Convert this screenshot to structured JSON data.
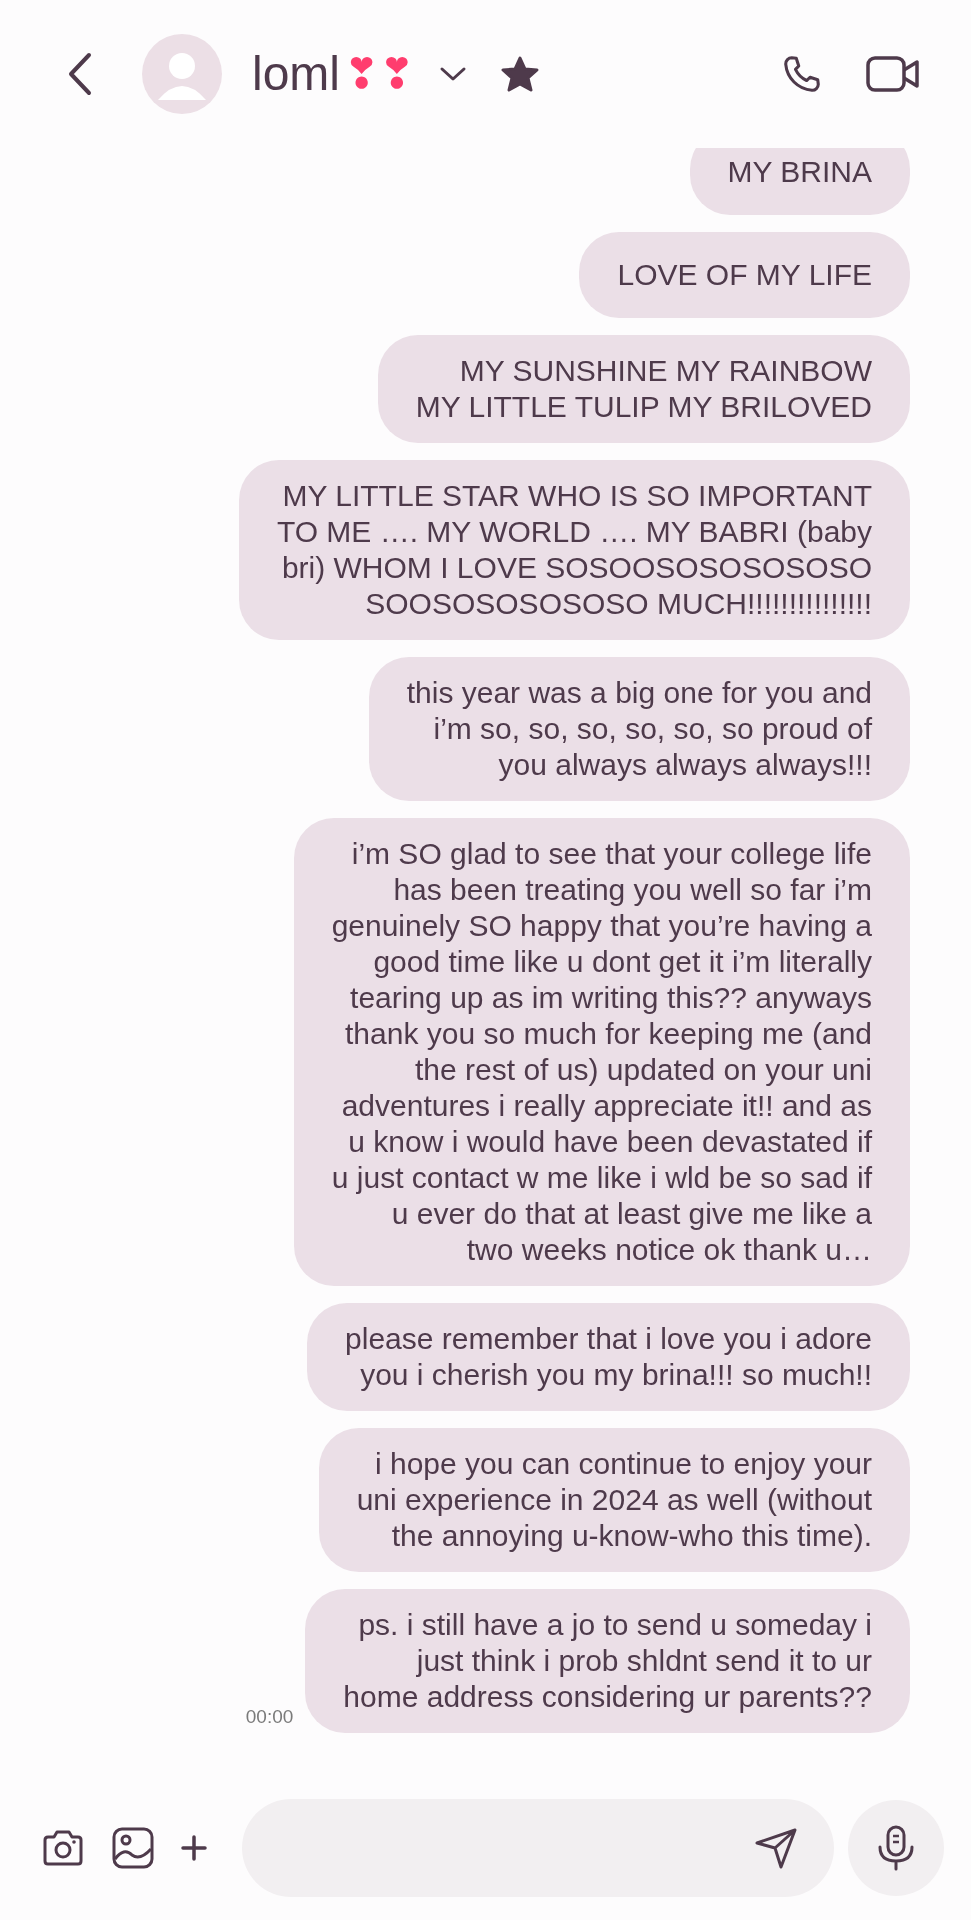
{
  "header": {
    "contact_name": "loml",
    "name_emoji": "❣❣",
    "starred": true
  },
  "messages": [
    {
      "lines": [
        "MY BRINA"
      ]
    },
    {
      "lines": [
        "LOVE OF MY LIFE"
      ]
    },
    {
      "lines": [
        "MY SUNSHINE MY RAINBOW",
        "MY LITTLE TULIP MY BRILOVED"
      ]
    },
    {
      "lines": [
        "MY LITTLE STAR WHO IS SO IMPORTANT",
        "TO ME …. MY WORLD …. MY BABRI (baby",
        "bri) WHOM I LOVE SOSOOSOSOSOSOSO",
        "SOOSOSOSOSOSO MUCH!!!!!!!!!!!!!!!"
      ]
    },
    {
      "lines": [
        "this year was a big one for you and",
        "i’m so, so, so, so, so, so proud of",
        "you always always always!!!"
      ]
    },
    {
      "lines": [
        "i’m SO glad to see that your college life",
        "has been treating you well so far i’m",
        "genuinely SO happy that you’re having a",
        "good time like u dont get it i’m literally",
        "tearing up as im writing this?? anyways",
        "thank you so much for keeping me (and",
        "the rest of us) updated on your uni",
        "adventures i really appreciate it!! and as",
        "u know i would have been devastated if",
        "u just contact w me like i wld be so sad if",
        "u ever do that at least give me like a",
        "two weeks notice ok thank u…"
      ]
    },
    {
      "lines": [
        "please remember that i love you i adore",
        "you i cherish you my brina!!! so much!!"
      ]
    },
    {
      "lines": [
        "i hope you can continue to enjoy your",
        "uni experience in 2024 as well (without",
        "the annoying u-know-who this time)."
      ]
    },
    {
      "lines": [
        "ps. i still have a jo to send u someday i",
        "just think i prob shldnt send it to ur",
        "home address considering ur parents??"
      ]
    }
  ],
  "timestamp": "00:00"
}
